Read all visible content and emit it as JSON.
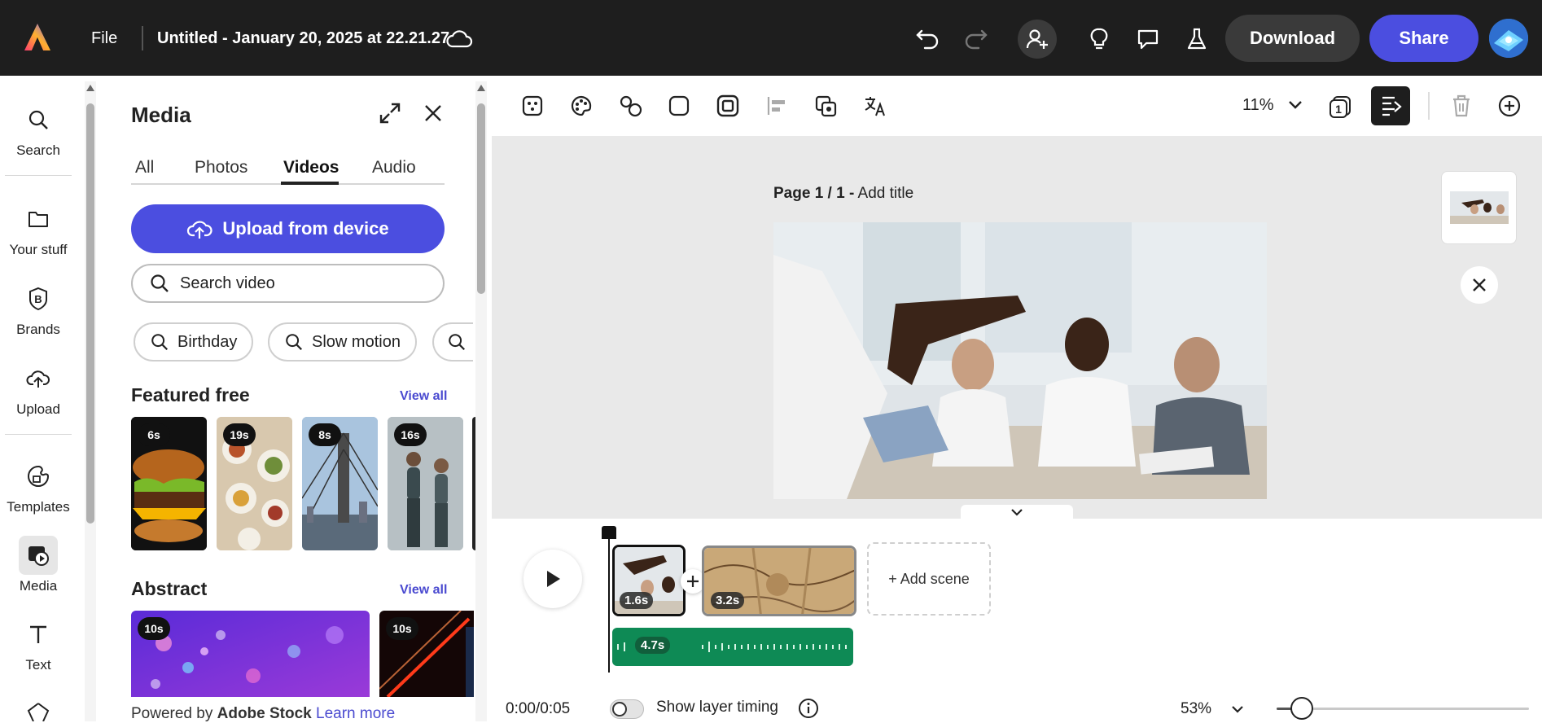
{
  "topbar": {
    "file_label": "File",
    "doc_title": "Untitled - January 20, 2025 at 22.21.27",
    "download_label": "Download",
    "share_label": "Share",
    "colors": {
      "bar": "#1e1e1e",
      "share": "#4b4ee0",
      "download": "#3a3a3a"
    }
  },
  "rail": {
    "items": [
      {
        "label": "Search",
        "icon": "search-icon"
      },
      {
        "label": "Your stuff",
        "icon": "folder-icon"
      },
      {
        "label": "Brands",
        "icon": "brands-icon"
      },
      {
        "label": "Upload",
        "icon": "cloud-upload-icon"
      },
      {
        "label": "Templates",
        "icon": "templates-icon"
      },
      {
        "label": "Media",
        "icon": "media-icon"
      },
      {
        "label": "Text",
        "icon": "text-icon"
      }
    ]
  },
  "media_panel": {
    "title": "Media",
    "tabs": [
      "All",
      "Photos",
      "Videos",
      "Audio"
    ],
    "active_tab": "Videos",
    "upload_label": "Upload from device",
    "search_placeholder": "Search video",
    "chips": [
      "Birthday",
      "Slow motion"
    ],
    "sections": [
      {
        "title": "Featured free",
        "view_all": "View all",
        "durations": [
          "6s",
          "19s",
          "8s",
          "16s"
        ]
      },
      {
        "title": "Abstract",
        "view_all": "View all",
        "durations": [
          "10s",
          "10s"
        ]
      }
    ],
    "footer_prefix": "Powered by",
    "footer_brand": "Adobe Stock",
    "footer_link": "Learn more"
  },
  "canvas": {
    "zoom": "11%",
    "page_label": "Page 1 / 1 -",
    "add_title": "Add title"
  },
  "timeline": {
    "scenes": [
      {
        "duration": "1.6s"
      },
      {
        "duration": "3.2s"
      }
    ],
    "add_scene_label": "+ Add scene",
    "audio_duration": "4.7s",
    "time": "0:00/0:05",
    "layer_timing_label": "Show layer timing",
    "timeline_zoom": "53%",
    "timeline_zoom_level": 0.1
  }
}
